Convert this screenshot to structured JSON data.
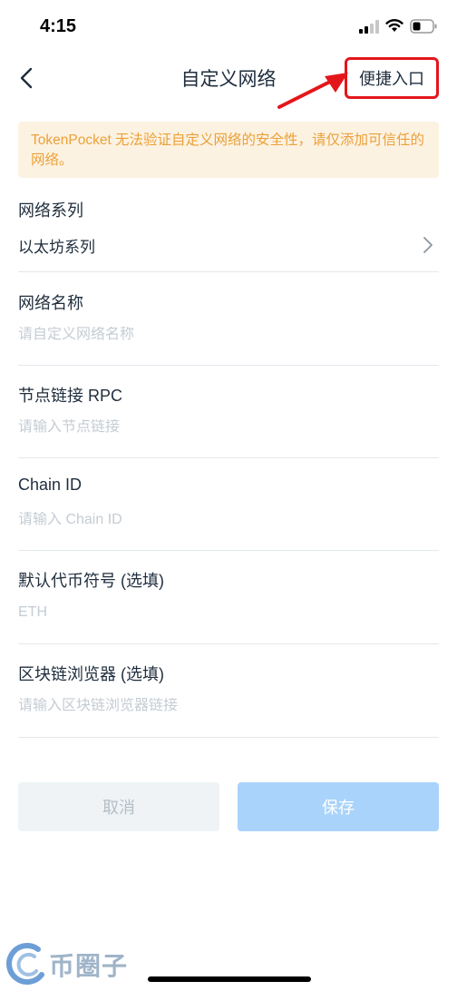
{
  "status_bar": {
    "time": "4:15"
  },
  "nav": {
    "title": "自定义网络",
    "shortcut_label": "便捷入口"
  },
  "warning": "TokenPocket 无法验证自定义网络的安全性，请仅添加可信任的网络。",
  "form": {
    "network_series": {
      "label": "网络系列",
      "value": "以太坊系列"
    },
    "network_name": {
      "label": "网络名称",
      "placeholder": "请自定义网络名称"
    },
    "rpc": {
      "label": "节点链接 RPC",
      "placeholder": "请输入节点链接"
    },
    "chain_id": {
      "label": "Chain ID",
      "placeholder": "请输入 Chain ID"
    },
    "symbol": {
      "label": "默认代币符号 (选填)",
      "placeholder": "ETH"
    },
    "explorer": {
      "label": "区块链浏览器 (选填)",
      "placeholder": "请输入区块链浏览器链接"
    }
  },
  "buttons": {
    "cancel": "取消",
    "save": "保存"
  },
  "watermark": {
    "text": "币圈子"
  },
  "colors": {
    "accent": "#a9d3fb",
    "warning_text": "#eba138",
    "warning_bg": "#fcf2e2",
    "highlight": "#e3161b"
  }
}
